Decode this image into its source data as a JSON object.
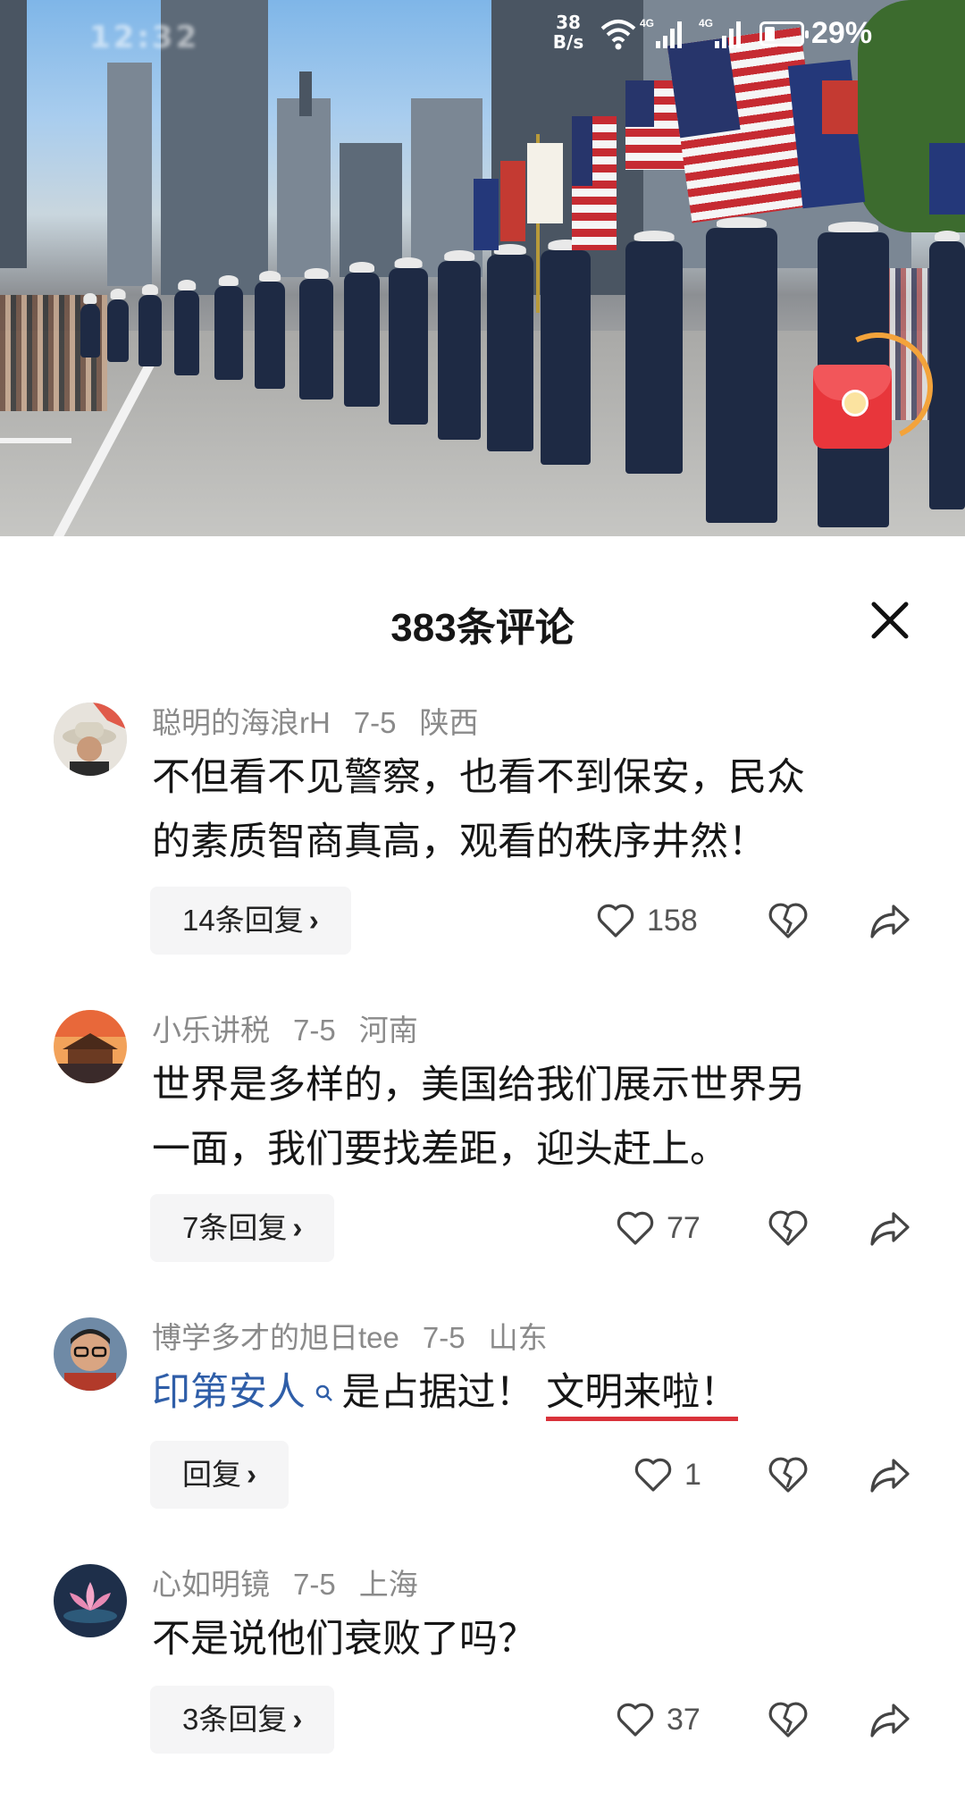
{
  "status_bar": {
    "time": "12:32",
    "net_speed_value": "38",
    "net_speed_unit": "B/s",
    "signal1": "4G",
    "signal2": "4G",
    "battery_text": "29%",
    "battery_level": 0.29
  },
  "sheet": {
    "title": "383条评论"
  },
  "comments": [
    {
      "author": "聪明的海浪rH",
      "date": "7-5",
      "location": "陕西",
      "text_line1": "不但看不见警察，也看不到保安，民众",
      "text_line2": "的素质智商真高，观看的秩序井然！",
      "reply_label": "14条回复",
      "likes": "158"
    },
    {
      "author": "小乐讲税",
      "date": "7-5",
      "location": "河南",
      "text_line1": "世界是多样的，美国给我们展示世界另",
      "text_line2": "一面，我们要找差距，迎头赶上。",
      "reply_label": "7条回复",
      "likes": "77"
    },
    {
      "author": "博学多才的旭日tee",
      "date": "7-5",
      "location": "山东",
      "mention": "印第安人",
      "text_mid": " 是占据过！",
      "text_underlined": "文明来啦！",
      "reply_label": "回复",
      "likes": "1"
    },
    {
      "author": "心如明镜",
      "date": "7-5",
      "location": "上海",
      "text_line1": "不是说他们衰败了吗？",
      "reply_label": "3条回复",
      "likes": "37"
    }
  ],
  "chevron": "›",
  "icons": {
    "close": "close-icon",
    "like": "heart-icon",
    "dislike": "broken-heart-icon",
    "share": "share-arrow-icon",
    "search": "search-icon",
    "red_packet": "red-envelope-icon"
  },
  "colors": {
    "accent_link": "#2f5ea8",
    "annotation_underline": "#d9323a",
    "red_packet": "#e8363b",
    "ring": "#f3a33b"
  }
}
